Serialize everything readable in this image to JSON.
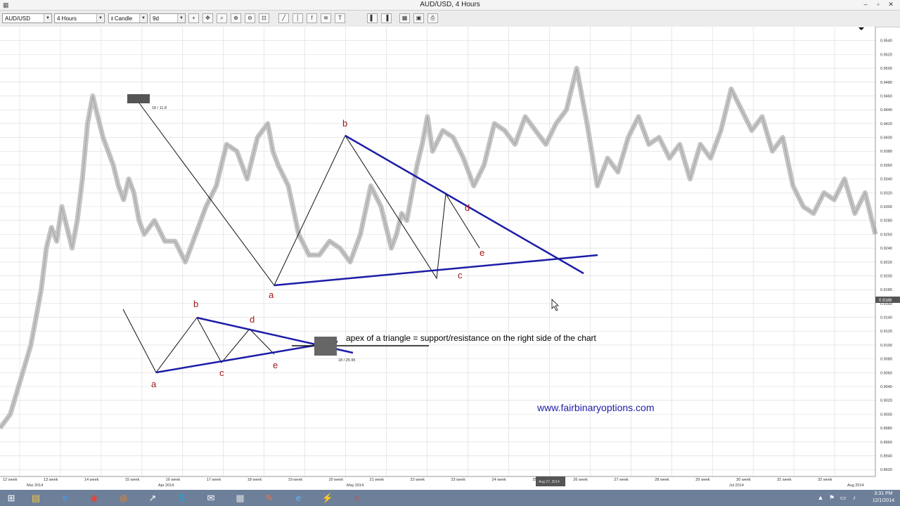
{
  "window": {
    "title": "AUD/USD,  4 Hours",
    "app_icon": "chart-app-icon",
    "minimize": "–",
    "maximize": "▫",
    "close": "✕"
  },
  "toolbar": {
    "symbol": "AUD/USD",
    "timeframe": "4 Hours",
    "chart_type": "Candle",
    "chart_type_icon": "bars-icon",
    "range": "9d",
    "buttons": [
      "crosshair-icon",
      "pan-icon",
      "zoom-icon",
      "zoom-in-icon",
      "zoom-out-icon",
      "zoom-fit-icon",
      "trendline-icon",
      "vertical-line-icon",
      "fx-icon",
      "fibonacci-icon",
      "text-icon",
      "bar-left-icon",
      "bar-right-icon",
      "grid-icon",
      "save-icon",
      "print-icon"
    ]
  },
  "chart_data": {
    "type": "line",
    "title": "",
    "y_ticks": [
      "0.9540",
      "0.9520",
      "0.9500",
      "0.9480",
      "0.9460",
      "0.9440",
      "0.9420",
      "0.9400",
      "0.9380",
      "0.9360",
      "0.9340",
      "0.9320",
      "0.9300",
      "0.9280",
      "0.9260",
      "0.9240",
      "0.9220",
      "0.9200",
      "0.9180",
      "0.9160",
      "0.9140",
      "0.9120",
      "0.9100",
      "0.9080",
      "0.9060",
      "0.9040",
      "0.9020",
      "0.9000",
      "0.8980",
      "0.8960",
      "0.8940",
      "0.8920"
    ],
    "ylim": [
      0.891,
      0.956
    ],
    "current_price": "0.9186",
    "x_week_labels": [
      "12 week",
      "13 week",
      "14 week",
      "15 week",
      "16 week",
      "17 week",
      "18 week",
      "19 week",
      "20 week",
      "21 week",
      "22 week",
      "23 week",
      "24 week",
      "25 week",
      "26 week",
      "27 week",
      "28 week",
      "29 week",
      "30 week",
      "31 week",
      "32 week"
    ],
    "x_month_labels": [
      "Mar 2014",
      "Apr 2014",
      "May 2014",
      "Jun 2014",
      "Jul 2014",
      "Aug 2014"
    ],
    "price_series": {
      "name": "",
      "x": [
        0,
        2,
        4,
        6,
        7,
        8,
        9,
        10,
        11,
        12,
        13,
        14,
        15,
        16,
        17,
        18,
        19,
        20,
        21,
        22,
        23,
        24,
        25,
        26,
        27,
        28,
        30,
        32,
        34,
        36,
        38,
        40,
        42,
        44,
        46,
        48,
        50,
        52,
        53,
        54,
        56,
        58,
        60,
        62,
        64,
        66,
        68,
        70,
        72,
        74,
        76,
        77,
        78,
        79,
        80,
        81,
        82,
        83,
        84,
        86,
        88,
        90,
        92,
        94,
        96,
        98,
        100,
        102,
        104,
        106,
        108,
        110,
        112,
        114,
        116,
        118,
        120,
        122,
        124,
        126,
        128,
        130,
        132,
        134,
        136,
        138,
        140,
        142,
        144,
        146,
        148,
        150,
        152,
        154,
        156,
        158,
        160,
        162,
        164,
        166,
        168,
        170
      ],
      "y": [
        0.898,
        0.9,
        0.905,
        0.91,
        0.914,
        0.918,
        0.924,
        0.927,
        0.925,
        0.93,
        0.927,
        0.924,
        0.928,
        0.934,
        0.942,
        0.946,
        0.943,
        0.94,
        0.938,
        0.936,
        0.933,
        0.931,
        0.934,
        0.932,
        0.928,
        0.926,
        0.928,
        0.925,
        0.925,
        0.922,
        0.926,
        0.93,
        0.933,
        0.939,
        0.938,
        0.934,
        0.94,
        0.942,
        0.938,
        0.936,
        0.933,
        0.926,
        0.923,
        0.923,
        0.925,
        0.924,
        0.922,
        0.926,
        0.933,
        0.93,
        0.924,
        0.926,
        0.929,
        0.928,
        0.932,
        0.936,
        0.939,
        0.943,
        0.938,
        0.941,
        0.94,
        0.937,
        0.933,
        0.936,
        0.942,
        0.941,
        0.939,
        0.943,
        0.941,
        0.939,
        0.942,
        0.944,
        0.95,
        0.942,
        0.933,
        0.937,
        0.935,
        0.94,
        0.943,
        0.939,
        0.94,
        0.937,
        0.939,
        0.934,
        0.939,
        0.937,
        0.941,
        0.947,
        0.944,
        0.941,
        0.943,
        0.938,
        0.94,
        0.933,
        0.93,
        0.929,
        0.932,
        0.931,
        0.934,
        0.929,
        0.932,
        0.926
      ]
    }
  },
  "annotations": {
    "wave_labels_main": [
      "b",
      "a",
      "c",
      "d",
      "e"
    ],
    "wave_labels_small": [
      "b",
      "d",
      "a",
      "c",
      "e"
    ],
    "tooltip_top": "18 / 11.8",
    "tooltip_apex": "18 / 25.95",
    "apex_text": "apex of a triangle = support/resistance on the right side of the chart",
    "watermark": "www.fairbinaryoptions.com",
    "bottom_box": "Aug 27, 2014"
  },
  "taskbar": {
    "start_icon": "windows-start-icon",
    "apps": [
      "file-explorer-icon",
      "internet-explorer-icon",
      "chrome-icon",
      "firefox-icon",
      "trading-icon",
      "skype-icon",
      "outlook-icon",
      "calculator-icon",
      "paint-icon",
      "ie-blue-icon",
      "network-icon",
      "opera-icon"
    ],
    "tray": [
      "arrow-up-icon",
      "flag-icon",
      "display-icon",
      "volume-icon"
    ],
    "time": "3:31 PM",
    "date": "12/1/2014"
  }
}
